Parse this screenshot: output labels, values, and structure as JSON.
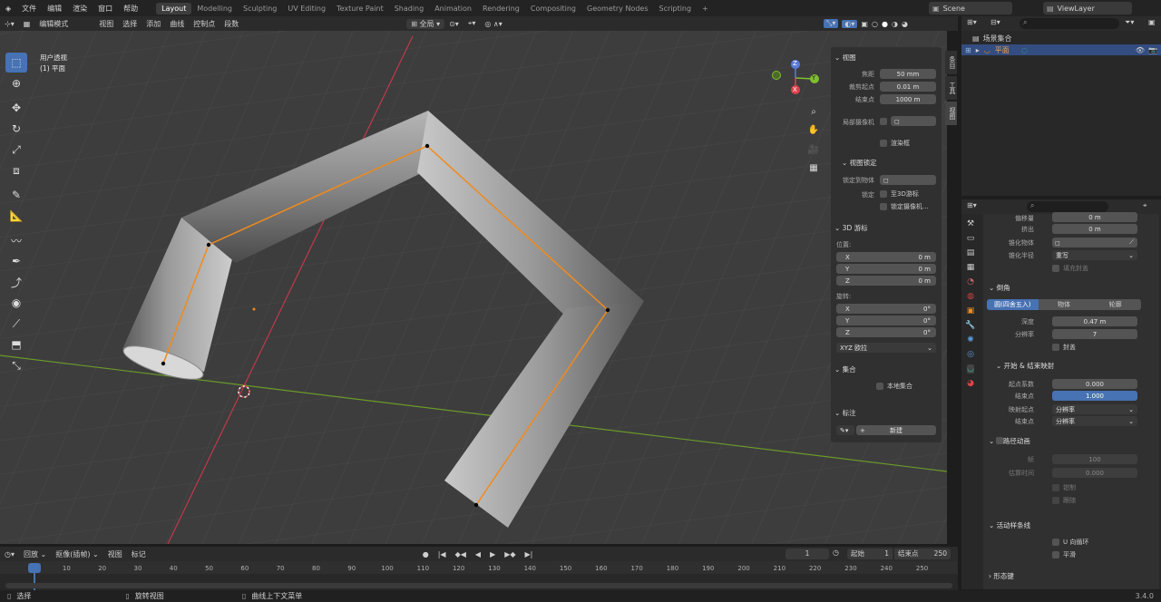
{
  "topbar": {
    "menus": [
      "文件",
      "编辑",
      "渲染",
      "窗口",
      "帮助"
    ],
    "workspaces": [
      "Layout",
      "Modelling",
      "Sculpting",
      "UV Editing",
      "Texture Paint",
      "Shading",
      "Animation",
      "Rendering",
      "Compositing",
      "Geometry Nodes",
      "Scripting"
    ],
    "active_workspace": "Layout",
    "add_tab": "+",
    "scene": "Scene",
    "view_layer": "ViewLayer"
  },
  "header": {
    "mode": "编辑模式",
    "menus": [
      "视图",
      "选择",
      "添加",
      "曲线",
      "控制点",
      "段数"
    ],
    "orientation": "全局"
  },
  "viewport": {
    "view_name": "用户透视",
    "object_name": "(1) 平面",
    "gizmo": {
      "x": "X",
      "y": "Y",
      "z": "Z"
    }
  },
  "npanel": {
    "view_title": "视图",
    "focal_label": "焦距",
    "focal_value": "50 mm",
    "clip_start_label": "裁剪起点",
    "clip_start_value": "0.01 m",
    "clip_end_label": "结束点",
    "clip_end_value": "1000 m",
    "local_camera_label": "局部摄像机",
    "render_region_label": "渲染框",
    "view_lock_title": "视图锁定",
    "lock_object_label": "锁定到物体",
    "lock_label": "锁定",
    "to_cursor_label": "至3D游标",
    "to_camera_label": "锁定摄像机...",
    "cursor_title": "3D 游标",
    "location_label": "位置:",
    "loc_x_label": "X",
    "loc_x": "0 m",
    "loc_y_label": "Y",
    "loc_y": "0 m",
    "loc_z_label": "Z",
    "loc_z": "0 m",
    "rotation_label": "旋转:",
    "rot_x_label": "X",
    "rot_x": "0°",
    "rot_y_label": "Y",
    "rot_y": "0°",
    "rot_z_label": "Z",
    "rot_z": "0°",
    "rotation_mode": "XYZ 欧拉",
    "collection_title": "集合",
    "local_collection_label": "本地集合",
    "annotation_title": "标注",
    "new_button": "新建",
    "side_tabs": [
      "条目",
      "工具",
      "视图"
    ]
  },
  "outliner": {
    "search_placeholder": "",
    "scene_collection": "场景集合",
    "object": "平面"
  },
  "properties": {
    "offset_label": "偏移量",
    "offset_value": "0 m",
    "extrude_label": "挤出",
    "extrude_value": "0 m",
    "taper_obj_label": "锥化物体",
    "taper_radius_label": "锥化半径",
    "taper_radius_value": "重写",
    "fill_caps_label": "填充封盖",
    "bevel_title": "倒角",
    "bevel_modes": [
      "圆(四舍五入)",
      "物体",
      "轮廓"
    ],
    "depth_label": "深度",
    "depth_value": "0.47 m",
    "resolution_label": "分辨率",
    "resolution_value": "7",
    "caps_label": "封盖",
    "start_end_title": "开始 & 结束映射",
    "bevel_start_label": "起点系数",
    "bevel_start_value": "0.000",
    "bevel_end_label": "结束点",
    "bevel_end_value": "1.000",
    "map_start_label": "映射起点",
    "map_start_value": "分辨率",
    "map_end_label": "结束点",
    "map_end_value": "分辨率",
    "path_anim_title": "路径动画",
    "frames_label": "帧",
    "frames_value": "100",
    "eval_time_label": "估算时间",
    "eval_time_value": "0.000",
    "clamp_label": "钳制",
    "follow_label": "跟随",
    "active_spline_title": "活动样条线",
    "cyclic_u_label": "U 向循环",
    "smooth_label": "平滑",
    "shape_title": "形态键"
  },
  "timeline": {
    "playback": "回放",
    "keying": "抠像(插帧)",
    "view": "视图",
    "marker": "标记",
    "current_frame": "1",
    "start_label": "起始",
    "start_value": "1",
    "end_label": "结束点",
    "end_value": "250",
    "ticks": [
      "1",
      "10",
      "20",
      "30",
      "40",
      "50",
      "60",
      "70",
      "80",
      "90",
      "100",
      "110",
      "120",
      "130",
      "140",
      "150",
      "160",
      "170",
      "180",
      "190",
      "200",
      "210",
      "220",
      "230",
      "240",
      "250"
    ]
  },
  "statusbar": {
    "select": "选择",
    "rotate_view": "旋转视图",
    "context_menu": "曲线上下文菜单",
    "version": "3.4.0"
  },
  "colors": {
    "accent": "#4772b3",
    "curve": "#f08a1c",
    "x_axis": "#e0404f",
    "y_axis": "#7fbf2f"
  }
}
